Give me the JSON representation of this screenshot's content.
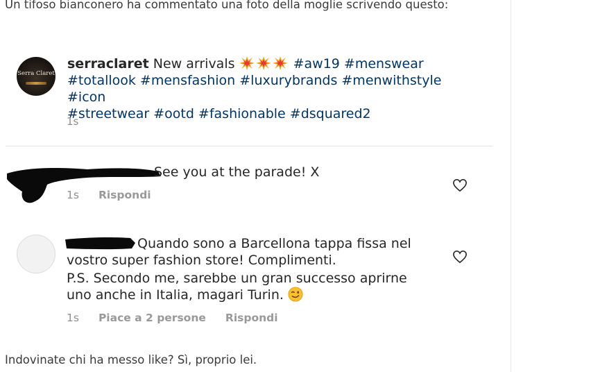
{
  "intro_text": "Un tifoso bianconero ha commentato una foto della moglie scrivendo questo:",
  "outro_text": "Indovinate chi ha messo like? Sì, proprio lei.",
  "post": {
    "avatar_text": "Serra Claret",
    "username": "serraclaret",
    "caption_text": "New arrivals",
    "emoji_icons": [
      "collision-emoji",
      "collision-emoji",
      "collision-emoji"
    ],
    "hashtags_line1": "#aw19 #menswear",
    "hashtags_line2": "#totallook #mensfashion #luxurybrands #menwithstyle #icon",
    "hashtags_line3": "#streetwear #ootd #fashionable #dsquared2",
    "time": "1s"
  },
  "comments": [
    {
      "text": "See you at the parade! X",
      "time": "1s",
      "reply_label": "Rispondi",
      "like_icon": "heart-outline-icon"
    },
    {
      "line1": "Quando sono a Barcellona tappa fissa nel",
      "line2": "vostro super fashion store! Complimenti.",
      "line3": "P.S. Secondo me, sarebbe un gran successo aprirne",
      "line4": "uno anche in Italia, magari Turin.",
      "emoji_icon": "winking-face-emoji",
      "time": "1s",
      "likes_label": "Piace a 2 persone",
      "reply_label": "Rispondi",
      "like_icon": "heart-outline-icon"
    }
  ],
  "colors": {
    "hashtag": "#003569",
    "meta": "#8e8e8e",
    "text": "#262626"
  }
}
